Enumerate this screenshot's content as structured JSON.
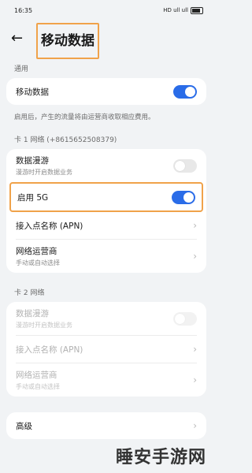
{
  "status_bar": {
    "time": "16:35",
    "signal_text": "HD ull ull",
    "battery_pct": 0.7
  },
  "header": {
    "back_icon": "arrow-left-icon",
    "title": "移动数据"
  },
  "general": {
    "section_label": "通用",
    "mobile_data_label": "移动数据",
    "mobile_data_on": true,
    "note": "启用后，产生的流量将由运营商收取相应费用。"
  },
  "sim1": {
    "section_label": "卡 1 网络 (+8615652508379)",
    "roaming_label": "数据漫游",
    "roaming_sub": "漫游时开启数据业务",
    "roaming_on": false,
    "enable5g_label": "启用 5G",
    "enable5g_on": true,
    "apn_label": "接入点名称 (APN)",
    "operator_label": "网络运营商",
    "operator_sub": "手动或自动选择"
  },
  "sim2": {
    "section_label": "卡 2 网络",
    "roaming_label": "数据漫游",
    "roaming_sub": "漫游时开启数据业务",
    "roaming_on": false,
    "apn_label": "接入点名称 (APN)",
    "operator_label": "网络运营商",
    "operator_sub": "手动或自动选择"
  },
  "advanced": {
    "label": "高级"
  },
  "colors": {
    "accent": "#2a6ce8",
    "highlight": "#f0a24a",
    "background": "#f1f3f5"
  },
  "watermark": "睡安手游网"
}
